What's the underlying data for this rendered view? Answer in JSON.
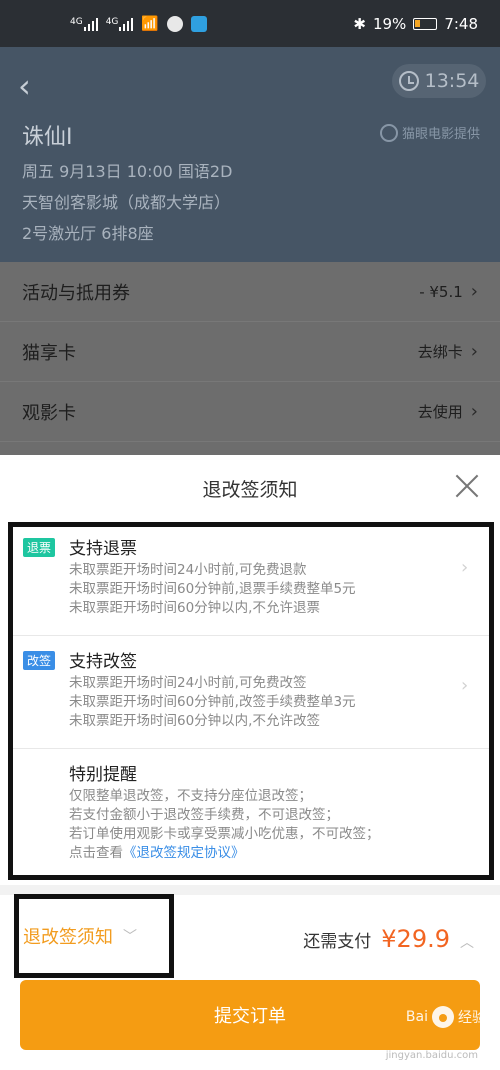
{
  "status_bar": {
    "signal_label_1": "4G",
    "signal_label_2": "4G",
    "battery": "19%",
    "time": "7:48"
  },
  "header": {
    "timer": "13:54",
    "movie_title": "诛仙Ⅰ",
    "provider": "猫眼电影提供",
    "showtime": "周五 9月13日 10:00 国语2D",
    "cinema": "天智创客影城（成都大学店）",
    "seat": "2号激光厅 6排8座"
  },
  "rows": [
    {
      "label": "活动与抵用券",
      "value": "- ¥5.1"
    },
    {
      "label": "猫享卡",
      "value": "去绑卡"
    },
    {
      "label": "观影卡",
      "value": "去使用"
    }
  ],
  "modal": {
    "title": "退改签须知",
    "refund": {
      "badge": "退票",
      "title": "支持退票",
      "lines": [
        "未取票距开场时间24小时前,可免费退款",
        "未取票距开场时间60分钟前,退票手续费整单5元",
        "未取票距开场时间60分钟以内,不允许退票"
      ]
    },
    "change": {
      "badge": "改签",
      "title": "支持改签",
      "lines": [
        "未取票距开场时间24小时前,可免费改签",
        "未取票距开场时间60分钟前,改签手续费整单3元",
        "未取票距开场时间60分钟以内,不允许改签"
      ]
    },
    "special": {
      "title": "特别提醒",
      "lines": [
        "仅限整单退改签，不支持分座位退改签；",
        "若支付金额小于退改签手续费，不可退改签；",
        "若订单使用观影卡或享受票减小吃优惠，不可改签；"
      ],
      "link_prefix": "点击查看",
      "link_text": "《退改签规定协议》"
    }
  },
  "footer": {
    "notice_toggle": "退改签须知",
    "pay_label": "还需支付",
    "pay_amount": "¥29.9",
    "submit": "提交订单"
  },
  "watermark": {
    "brand": "Bai",
    "brand_suffix": "经验",
    "sub": "jingyan.baidu.com"
  },
  "colors": {
    "accent_orange": "#f59c12",
    "price_red": "#f26522",
    "refund_badge": "#1ec6a0",
    "change_badge": "#3a8ee6",
    "header_bg": "#465565"
  }
}
